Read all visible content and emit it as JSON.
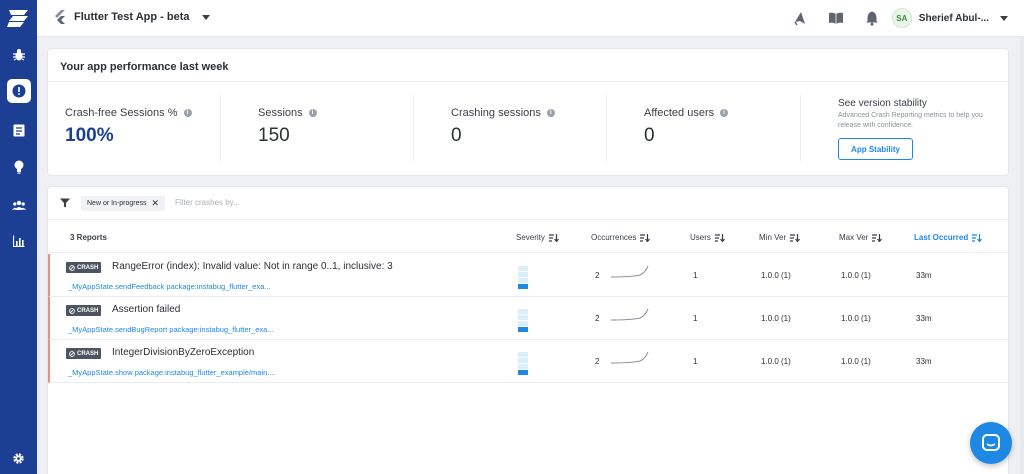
{
  "topbar": {
    "app_name": "Flutter Test App - beta",
    "user_initials": "SA",
    "user_name": "Sherief Abul-..."
  },
  "sidebar": {
    "items": [
      {
        "icon": "bug-icon"
      },
      {
        "icon": "crash-icon",
        "active": true
      },
      {
        "icon": "survey-icon"
      },
      {
        "icon": "lightbulb-icon"
      },
      {
        "icon": "users-icon"
      },
      {
        "icon": "chart-icon"
      },
      {
        "icon": "settings-icon"
      }
    ]
  },
  "performance": {
    "title": "Your app performance last week",
    "metrics": [
      {
        "label": "Crash-free Sessions %",
        "value": "100%"
      },
      {
        "label": "Sessions",
        "value": "150"
      },
      {
        "label": "Crashing sessions",
        "value": "0"
      },
      {
        "label": "Affected users",
        "value": "0"
      }
    ],
    "stability_title": "See version stability",
    "stability_desc": "Advanced Crash Reporting metrics to help you release with confidence.",
    "stability_button": "App Stability"
  },
  "filters": {
    "chip_label": "New or In-progress",
    "chip_remove": "✕",
    "placeholder": "Filter crashes by..."
  },
  "table": {
    "report_count": "3 Reports",
    "headers": {
      "severity": "Severity",
      "occurrences": "Occurrences",
      "users": "Users",
      "min_ver": "Min Ver",
      "max_ver": "Max Ver",
      "last_occurred": "Last Occurred"
    },
    "rows": [
      {
        "badge": "CRASH",
        "title": "RangeError (index): Invalid value: Not in range 0..1, inclusive: 3",
        "subtitle": "_MyAppState.sendFeedback package:instabug_flutter_exa...",
        "occurrences": "2",
        "users": "1",
        "min_ver": "1.0.0 (1)",
        "max_ver": "1.0.0 (1)",
        "last_occurred": "33m"
      },
      {
        "badge": "CRASH",
        "title": "Assertion failed",
        "subtitle": "_MyAppState.sendBugReport package:instabug_flutter_exa...",
        "occurrences": "2",
        "users": "1",
        "min_ver": "1.0.0 (1)",
        "max_ver": "1.0.0 (1)",
        "last_occurred": "33m"
      },
      {
        "badge": "CRASH",
        "title": "IntegerDivisionByZeroException",
        "subtitle": "_MyAppState.show package:instabug_flutter_example/main....",
        "occurrences": "2",
        "users": "1",
        "min_ver": "1.0.0 (1)",
        "max_ver": "1.0.0 (1)",
        "last_occurred": "33m"
      }
    ]
  },
  "colors": {
    "sidebar": "#1c3f94",
    "accent": "#1e88e5",
    "crash_border": "#f0897e"
  }
}
